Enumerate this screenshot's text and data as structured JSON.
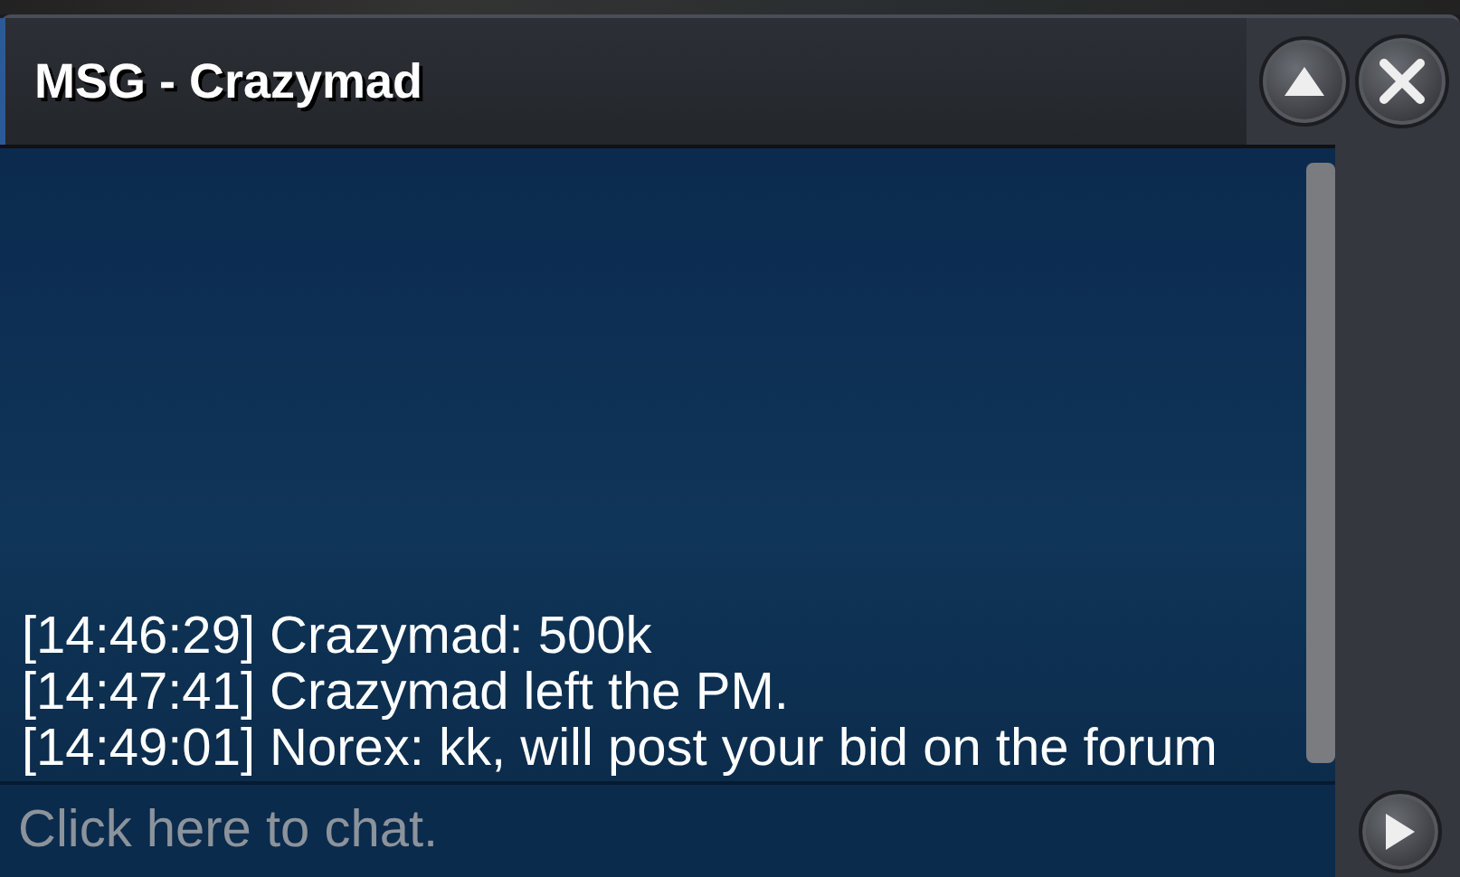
{
  "window": {
    "title": "MSG - Crazymad"
  },
  "messages": [
    {
      "text": "[14:46:29] Crazymad: 500k"
    },
    {
      "text": "[14:47:41] Crazymad left the PM."
    },
    {
      "text": "[14:49:01] Norex: kk, will post your bid on the forum"
    }
  ],
  "chat_input": {
    "placeholder": "Click here to chat."
  }
}
